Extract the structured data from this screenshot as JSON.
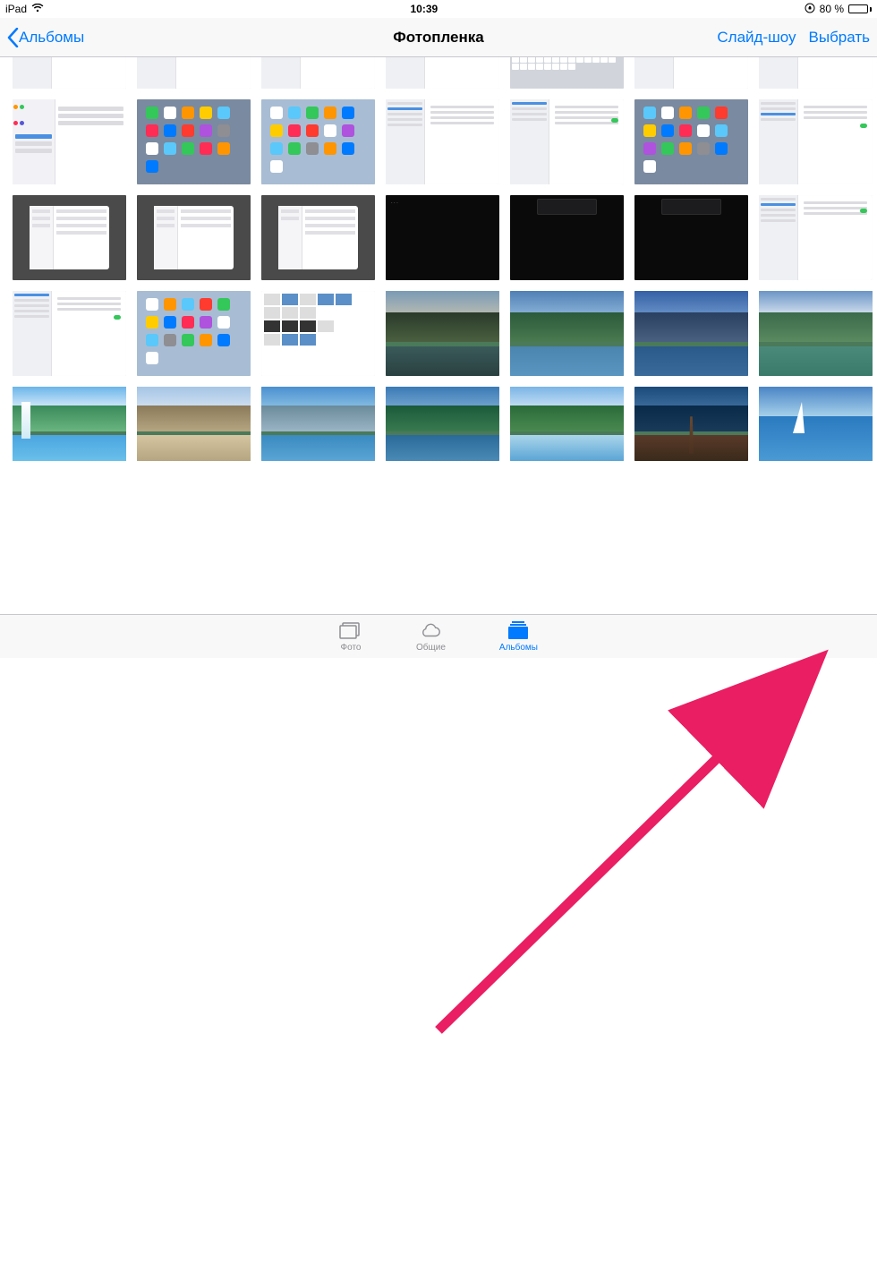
{
  "status": {
    "device": "iPad",
    "time": "10:39",
    "battery_pct": "80 %"
  },
  "nav": {
    "back_label": "Альбомы",
    "title": "Фотопленка",
    "slideshow": "Слайд-шоу",
    "select": "Выбрать"
  },
  "tabs": {
    "photos": "Фото",
    "shared": "Общие",
    "albums": "Альбомы"
  },
  "thumbnails": {
    "rows": [
      [
        "settings-list",
        "settings-list",
        "settings-list",
        "settings-list",
        "settings-keyboard",
        "settings-list",
        "settings-list"
      ],
      [
        "settings-list",
        "ipad-home-dark",
        "ipad-home-light",
        "settings-list",
        "settings-list",
        "ipad-home-dark",
        "settings-list"
      ],
      [
        "settings-modal",
        "settings-modal",
        "settings-modal",
        "dark-screen",
        "dark-dialog",
        "dark-dialog",
        "settings-list"
      ],
      [
        "settings-list",
        "ipad-home-light",
        "photo-gallery",
        "landscape-mountains-lake",
        "landscape-green-lake",
        "landscape-blue-peaks",
        "landscape-green-river"
      ],
      [
        "landscape-waterfall",
        "landscape-desert-lake",
        "landscape-snow-lake",
        "landscape-forest-lake",
        "landscape-tropical",
        "landscape-pier-sunset",
        "landscape-sailboat"
      ]
    ]
  },
  "colors": {
    "tint": "#007aff",
    "arrow": "#e91e63"
  }
}
